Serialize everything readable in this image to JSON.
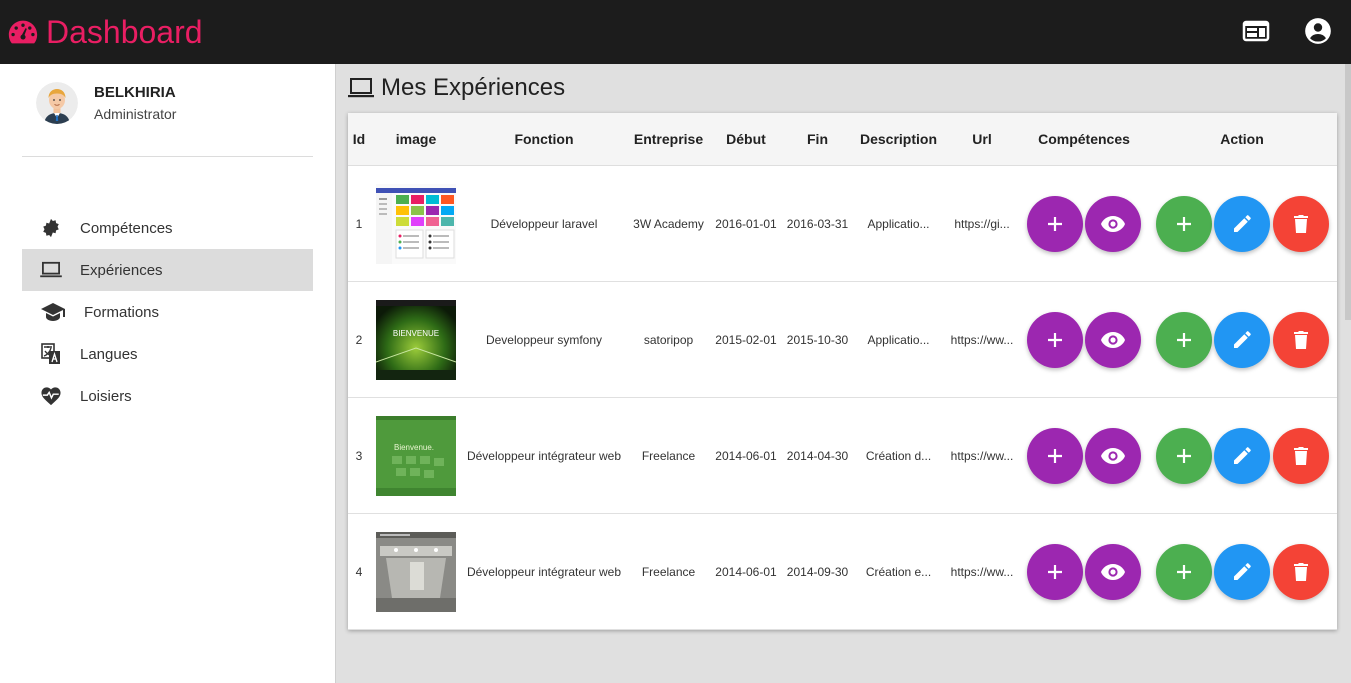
{
  "app": {
    "title": "Dashboard",
    "brand_color": "#e91e63",
    "topbar_icons": [
      "web-layout-icon",
      "account-circle-icon"
    ]
  },
  "profile": {
    "name": "BELKHIRIA",
    "role": "Administrator"
  },
  "sidebar": {
    "items": [
      {
        "label": "Compétences",
        "icon": "gear-badge-icon",
        "active": false
      },
      {
        "label": "Expériences",
        "icon": "laptop-icon",
        "active": true
      },
      {
        "label": "Formations",
        "icon": "graduation-cap-icon",
        "active": false
      },
      {
        "label": "Langues",
        "icon": "translate-icon",
        "active": false
      },
      {
        "label": "Loisiers",
        "icon": "heart-pulse-icon",
        "active": false
      }
    ]
  },
  "page": {
    "title": "Mes Expériences",
    "icon": "laptop-icon"
  },
  "table": {
    "headers": {
      "id": "Id",
      "image": "image",
      "fonction": "Fonction",
      "entreprise": "Entreprise",
      "debut": "Début",
      "fin": "Fin",
      "description": "Description",
      "url": "Url",
      "competences": "Compétences",
      "action": "Action"
    },
    "rows": [
      {
        "id": "1",
        "fonction": "Développeur laravel",
        "entreprise": "3W Academy",
        "debut": "2016-01-01",
        "fin": "2016-03-31",
        "description": "Applicatio...",
        "url": "https://gi...",
        "image": "dashboard-tiles-screenshot"
      },
      {
        "id": "2",
        "fonction": "Developpeur symfony",
        "entreprise": "satoripop",
        "debut": "2015-02-01",
        "fin": "2015-10-30",
        "description": "Applicatio...",
        "url": "https://ww...",
        "image": "football-stadium-bienvenue"
      },
      {
        "id": "3",
        "fonction": "Développeur intégrateur web",
        "entreprise": "Freelance",
        "debut": "2014-06-01",
        "fin": "2014-04-30",
        "description": "Création d...",
        "url": "https://ww...",
        "image": "green-bienvenue-page"
      },
      {
        "id": "4",
        "fonction": "Développeur intégrateur web",
        "entreprise": "Freelance",
        "debut": "2014-06-01",
        "fin": "2014-09-30",
        "description": "Création e...",
        "url": "https://ww...",
        "image": "event-hall-photo"
      }
    ],
    "button_colors": {
      "competences_add": "#9c27b0",
      "competences_view": "#9c27b0",
      "action_add": "#4caf50",
      "action_edit": "#2196f3",
      "action_delete": "#f44336"
    }
  }
}
